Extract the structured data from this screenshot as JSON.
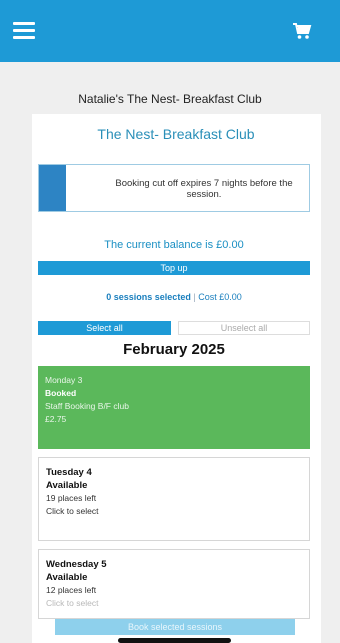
{
  "header": {
    "menu_icon": "hamburger-menu-icon",
    "cart_icon": "shopping-cart-icon",
    "color": "#1e9ad6"
  },
  "page_title": "Natalie's The Nest- Breakfast Club",
  "club_title": "The Nest- Breakfast Club",
  "notice": "Booking cut off expires 7 nights before the session.",
  "balance_text": "The current balance is £0.00",
  "topup_label": "Top up",
  "selection": {
    "count": "0 sessions selected",
    "sep": "|",
    "cost": "Cost £0.00"
  },
  "select_all_label": "Select all",
  "unselect_all_label": "Unselect all",
  "month": "February 2025",
  "days": [
    {
      "name": "Monday 3",
      "status": "Booked",
      "line1": "Staff Booking B/F club",
      "line2": "£2.75",
      "color": "#5bb85b"
    },
    {
      "name": "Tuesday 4",
      "status": "Available",
      "line1": "19 places left",
      "line2": "Click to select"
    },
    {
      "name": "Wednesday 5",
      "status": "Available",
      "line1": "12 places left",
      "line2": "Click to select"
    }
  ],
  "book_button_label": "Book selected sessions"
}
